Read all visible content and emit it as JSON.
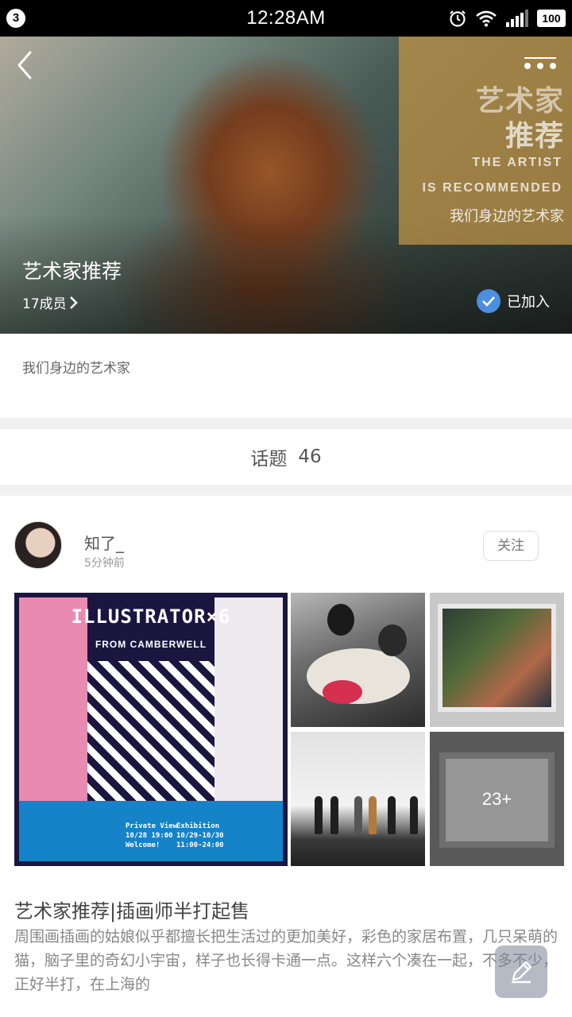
{
  "status_bar": {
    "notification_count": "3",
    "time": "12:28AM",
    "battery": "100",
    "icons": [
      "alarm-icon",
      "wifi-icon",
      "signal-icon",
      "battery-icon"
    ]
  },
  "header": {
    "back_icon": "chevron-left-icon",
    "more_icon": "more-dots-icon",
    "banner": {
      "line1": "艺术家",
      "line2": "推荐",
      "line3": "THE ARTIST",
      "line4": "IS RECOMMENDED",
      "line5": "我们身边的艺术家"
    },
    "group_name": "艺术家推荐",
    "members": "17成员",
    "joined_label": "已加入"
  },
  "group": {
    "description": "我们身边的艺术家"
  },
  "topics": {
    "label": "话题",
    "count": "46"
  },
  "post": {
    "author": "知了_",
    "time": "5分钟前",
    "follow_label": "关注",
    "poster": {
      "title": "ILLUSTRATOR×6",
      "subtitle": "FROM CAMBERWELL",
      "private_view": [
        "Private View",
        "10/28 19:00",
        "Welcome!"
      ],
      "exhibition": [
        "Exhibition",
        "10/29-10/30",
        "11:00-24:00"
      ]
    },
    "more_images": "23+",
    "title": "艺术家推荐|插画师半打起售",
    "body": "周围画插画的姑娘似乎都擅长把生活过的更加美好，彩色的家居布置，几只呆萌的猫，脑子里的奇幻小宇宙，样子也长得卡通一点。这样六个凑在一起，不多不少，正好半打，在上海的"
  },
  "colors": {
    "accent": "#4a8fe0",
    "banner_overlay": "#c49646",
    "separator": "#f1f1f1"
  }
}
